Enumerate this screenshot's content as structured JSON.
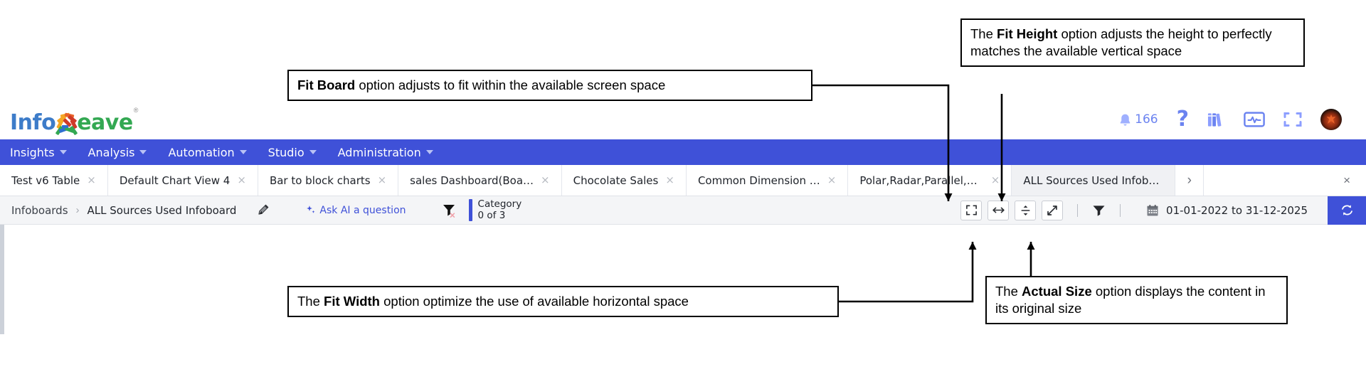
{
  "header": {
    "logo": {
      "part1": "Info",
      "part2": "eave",
      "registered": "®",
      "icon_name": "infoweave-logo"
    },
    "icons": {
      "bell": {
        "name": "bell-icon",
        "count": "166"
      },
      "help": {
        "name": "help-question-icon",
        "glyph": "?"
      },
      "library": {
        "name": "library-books-icon"
      },
      "monitor": {
        "name": "monitor-chart-icon"
      },
      "fullscreen": {
        "name": "fullscreen-icon"
      },
      "avatar": {
        "name": "user-avatar"
      }
    }
  },
  "nav": {
    "items": [
      {
        "label": "Insights",
        "has_caret": true
      },
      {
        "label": "Analysis",
        "has_caret": true
      },
      {
        "label": "Automation",
        "has_caret": true
      },
      {
        "label": "Studio",
        "has_caret": true
      },
      {
        "label": "Administration",
        "has_caret": true
      }
    ]
  },
  "tabs": {
    "items": [
      {
        "label": "Test v6 Table",
        "active": false
      },
      {
        "label": "Default Chart View 4",
        "active": false
      },
      {
        "label": "Bar to block charts",
        "active": false
      },
      {
        "label": "sales Dashboard(Boa…",
        "active": false
      },
      {
        "label": "Chocolate Sales",
        "active": false
      },
      {
        "label": "Common Dimension …",
        "active": false
      },
      {
        "label": "Polar,Radar,Parallel,Si…",
        "active": false
      },
      {
        "label": "ALL Sources Used Infoboa…",
        "active": true
      }
    ],
    "close_glyph": "×",
    "next_glyph": "›",
    "close_all_glyph": "×"
  },
  "breadcrumb": {
    "root": "Infoboards",
    "separator": "›",
    "current": "ALL Sources Used Infoboard",
    "edit_icon": "pencil-icon",
    "ask_ai": "Ask AI a question",
    "ask_ai_icon": "sparkle-icon",
    "clear_filter_icon": "clear-filter-icon"
  },
  "filter_chip": {
    "title": "Category",
    "subtitle": "0 of 3"
  },
  "toolbar": {
    "buttons": [
      {
        "label": "Fit Board",
        "icon": "fit-board-icon"
      },
      {
        "label": "Fit Width",
        "icon": "fit-width-icon"
      },
      {
        "label": "Fit Height",
        "icon": "fit-height-icon"
      },
      {
        "label": "Actual Size",
        "icon": "actual-size-icon"
      }
    ],
    "funnel_icon": "funnel-filter-icon",
    "calendar_icon": "calendar-icon",
    "date_range": "01-01-2022 to 31-12-2025",
    "refresh_icon": "refresh-icon"
  },
  "annotations": [
    {
      "id": "fit-board",
      "bold": "Fit Board",
      "prefix": "",
      "suffix": " option adjusts to fit within the available screen space"
    },
    {
      "id": "fit-height",
      "bold": "Fit Height",
      "prefix": "The ",
      "suffix": " option adjusts the height to perfectly matches the available vertical space"
    },
    {
      "id": "fit-width",
      "bold": "Fit Width",
      "prefix": "The ",
      "suffix": " option optimize the use of available horizontal space"
    },
    {
      "id": "actual-size",
      "bold": "Actual Size",
      "prefix": "The ",
      "suffix": " option displays the content in its original size"
    }
  ],
  "colors": {
    "brand_blue": "#3f51d8",
    "nav_bg": "#3f51d8",
    "toolbar_bg": "#f4f5f7",
    "logo_blue": "#3d7cc9",
    "logo_green": "#33a852",
    "icon_lavender": "#8c9eff"
  }
}
